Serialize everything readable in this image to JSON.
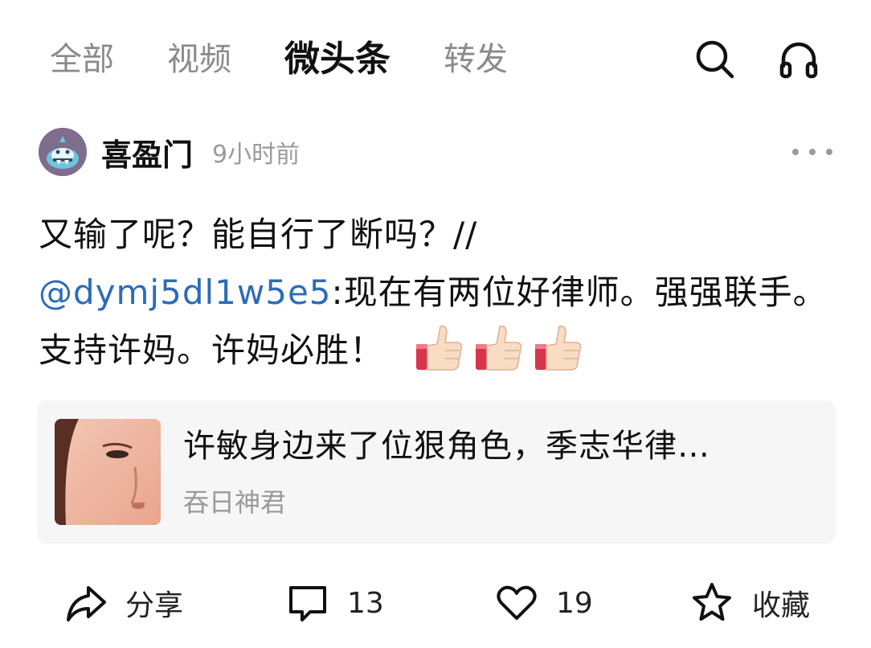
{
  "tabs": [
    {
      "label": "全部"
    },
    {
      "label": "视频"
    },
    {
      "label": "微头条",
      "active": true
    },
    {
      "label": "转发"
    }
  ],
  "top_icons": [
    "search-icon",
    "headphones-icon"
  ],
  "post": {
    "author": "喜盈门",
    "time": "9小时前",
    "text_part1": "又输了呢？能自行了断吗？//",
    "mention": "@dymj5dl1w5e5",
    "text_part2": ":现在有两位好律师。强强联手。支持许妈。许妈必胜！",
    "emoji": [
      "thumbs-up",
      "thumbs-up",
      "thumbs-up"
    ]
  },
  "card": {
    "title": "许敏身边来了位狠角色，季志华律…",
    "source": "吞日神君"
  },
  "actions": {
    "share": "分享",
    "comments": "13",
    "likes": "19",
    "favorite": "收藏"
  },
  "colors": {
    "mention": "#2b6cb8",
    "muted": "#9a9a9a",
    "card_bg": "#f6f6f6"
  }
}
